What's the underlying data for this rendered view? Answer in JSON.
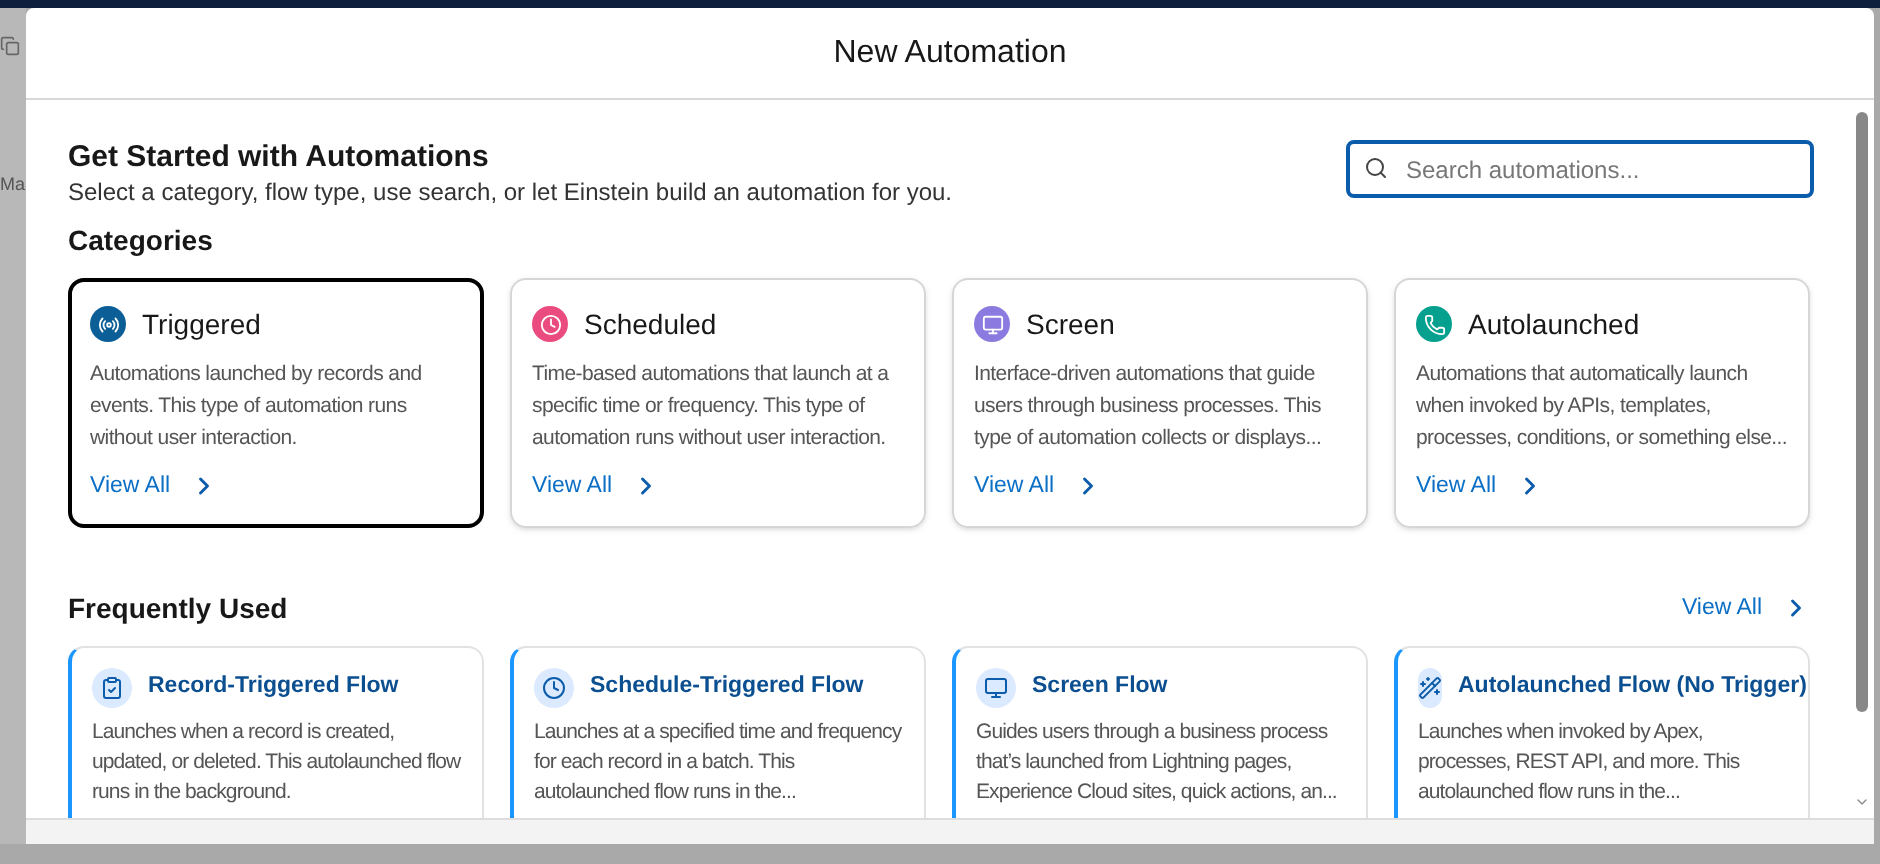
{
  "background_page": {
    "fragment": "Ma"
  },
  "modal": {
    "title": "New Automation"
  },
  "intro": {
    "title": "Get Started with Automations",
    "subtitle": "Select a category, flow type, use search, or let Einstein build an automation for you."
  },
  "search": {
    "placeholder": "Search automations..."
  },
  "categories": {
    "heading": "Categories",
    "items": [
      {
        "kind": "triggered",
        "title": "Triggered",
        "description": "Automations launched by records and events. This type of automation runs without user interaction.",
        "link": "View All",
        "selected": true,
        "color": "#0b5f96"
      },
      {
        "kind": "scheduled",
        "title": "Scheduled",
        "description": "Time-based automations that launch at a specific time or frequency. This type of automation runs without user interaction.",
        "link": "View All",
        "selected": false,
        "color": "#ea4c7f"
      },
      {
        "kind": "screen",
        "title": "Screen",
        "description": "Interface-driven automations that guide users through business processes. This type of automation collects or displays...",
        "link": "View All",
        "selected": false,
        "color": "#8b7be0"
      },
      {
        "kind": "autolaunched",
        "title": "Autolaunched",
        "description": "Automations that automatically launch when invoked by APIs, templates, processes, conditions, or something else...",
        "link": "View All",
        "selected": false,
        "color": "#06a08f"
      }
    ]
  },
  "frequently_used": {
    "heading": "Frequently Used",
    "link": "View All",
    "items": [
      {
        "kind": "record",
        "title": "Record-Triggered Flow",
        "description": "Launches when a record is created, updated, or deleted. This autolaunched flow runs in the background."
      },
      {
        "kind": "schedule",
        "title": "Schedule-Triggered Flow",
        "description": "Launches at a specified time and frequency for each record in a batch. This autolaunched flow runs in the..."
      },
      {
        "kind": "screen",
        "title": "Screen Flow",
        "description": "Guides users through a business process that’s launched from Lightning pages, Experience Cloud sites, quick actions, an..."
      },
      {
        "kind": "autolaunched",
        "title": "Autolaunched Flow (No Trigger)",
        "description": "Launches when invoked by Apex, processes, REST API, and more. This autolaunched flow runs in the..."
      }
    ]
  }
}
